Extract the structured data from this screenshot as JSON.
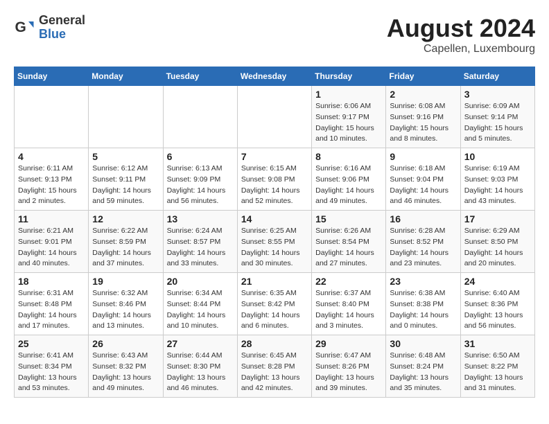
{
  "header": {
    "logo_general": "General",
    "logo_blue": "Blue",
    "month": "August 2024",
    "location": "Capellen, Luxembourg"
  },
  "weekdays": [
    "Sunday",
    "Monday",
    "Tuesday",
    "Wednesday",
    "Thursday",
    "Friday",
    "Saturday"
  ],
  "weeks": [
    [
      {
        "day": "",
        "info": ""
      },
      {
        "day": "",
        "info": ""
      },
      {
        "day": "",
        "info": ""
      },
      {
        "day": "",
        "info": ""
      },
      {
        "day": "1",
        "info": "Sunrise: 6:06 AM\nSunset: 9:17 PM\nDaylight: 15 hours\nand 10 minutes."
      },
      {
        "day": "2",
        "info": "Sunrise: 6:08 AM\nSunset: 9:16 PM\nDaylight: 15 hours\nand 8 minutes."
      },
      {
        "day": "3",
        "info": "Sunrise: 6:09 AM\nSunset: 9:14 PM\nDaylight: 15 hours\nand 5 minutes."
      }
    ],
    [
      {
        "day": "4",
        "info": "Sunrise: 6:11 AM\nSunset: 9:13 PM\nDaylight: 15 hours\nand 2 minutes."
      },
      {
        "day": "5",
        "info": "Sunrise: 6:12 AM\nSunset: 9:11 PM\nDaylight: 14 hours\nand 59 minutes."
      },
      {
        "day": "6",
        "info": "Sunrise: 6:13 AM\nSunset: 9:09 PM\nDaylight: 14 hours\nand 56 minutes."
      },
      {
        "day": "7",
        "info": "Sunrise: 6:15 AM\nSunset: 9:08 PM\nDaylight: 14 hours\nand 52 minutes."
      },
      {
        "day": "8",
        "info": "Sunrise: 6:16 AM\nSunset: 9:06 PM\nDaylight: 14 hours\nand 49 minutes."
      },
      {
        "day": "9",
        "info": "Sunrise: 6:18 AM\nSunset: 9:04 PM\nDaylight: 14 hours\nand 46 minutes."
      },
      {
        "day": "10",
        "info": "Sunrise: 6:19 AM\nSunset: 9:03 PM\nDaylight: 14 hours\nand 43 minutes."
      }
    ],
    [
      {
        "day": "11",
        "info": "Sunrise: 6:21 AM\nSunset: 9:01 PM\nDaylight: 14 hours\nand 40 minutes."
      },
      {
        "day": "12",
        "info": "Sunrise: 6:22 AM\nSunset: 8:59 PM\nDaylight: 14 hours\nand 37 minutes."
      },
      {
        "day": "13",
        "info": "Sunrise: 6:24 AM\nSunset: 8:57 PM\nDaylight: 14 hours\nand 33 minutes."
      },
      {
        "day": "14",
        "info": "Sunrise: 6:25 AM\nSunset: 8:55 PM\nDaylight: 14 hours\nand 30 minutes."
      },
      {
        "day": "15",
        "info": "Sunrise: 6:26 AM\nSunset: 8:54 PM\nDaylight: 14 hours\nand 27 minutes."
      },
      {
        "day": "16",
        "info": "Sunrise: 6:28 AM\nSunset: 8:52 PM\nDaylight: 14 hours\nand 23 minutes."
      },
      {
        "day": "17",
        "info": "Sunrise: 6:29 AM\nSunset: 8:50 PM\nDaylight: 14 hours\nand 20 minutes."
      }
    ],
    [
      {
        "day": "18",
        "info": "Sunrise: 6:31 AM\nSunset: 8:48 PM\nDaylight: 14 hours\nand 17 minutes."
      },
      {
        "day": "19",
        "info": "Sunrise: 6:32 AM\nSunset: 8:46 PM\nDaylight: 14 hours\nand 13 minutes."
      },
      {
        "day": "20",
        "info": "Sunrise: 6:34 AM\nSunset: 8:44 PM\nDaylight: 14 hours\nand 10 minutes."
      },
      {
        "day": "21",
        "info": "Sunrise: 6:35 AM\nSunset: 8:42 PM\nDaylight: 14 hours\nand 6 minutes."
      },
      {
        "day": "22",
        "info": "Sunrise: 6:37 AM\nSunset: 8:40 PM\nDaylight: 14 hours\nand 3 minutes."
      },
      {
        "day": "23",
        "info": "Sunrise: 6:38 AM\nSunset: 8:38 PM\nDaylight: 14 hours\nand 0 minutes."
      },
      {
        "day": "24",
        "info": "Sunrise: 6:40 AM\nSunset: 8:36 PM\nDaylight: 13 hours\nand 56 minutes."
      }
    ],
    [
      {
        "day": "25",
        "info": "Sunrise: 6:41 AM\nSunset: 8:34 PM\nDaylight: 13 hours\nand 53 minutes."
      },
      {
        "day": "26",
        "info": "Sunrise: 6:43 AM\nSunset: 8:32 PM\nDaylight: 13 hours\nand 49 minutes."
      },
      {
        "day": "27",
        "info": "Sunrise: 6:44 AM\nSunset: 8:30 PM\nDaylight: 13 hours\nand 46 minutes."
      },
      {
        "day": "28",
        "info": "Sunrise: 6:45 AM\nSunset: 8:28 PM\nDaylight: 13 hours\nand 42 minutes."
      },
      {
        "day": "29",
        "info": "Sunrise: 6:47 AM\nSunset: 8:26 PM\nDaylight: 13 hours\nand 39 minutes."
      },
      {
        "day": "30",
        "info": "Sunrise: 6:48 AM\nSunset: 8:24 PM\nDaylight: 13 hours\nand 35 minutes."
      },
      {
        "day": "31",
        "info": "Sunrise: 6:50 AM\nSunset: 8:22 PM\nDaylight: 13 hours\nand 31 minutes."
      }
    ]
  ]
}
